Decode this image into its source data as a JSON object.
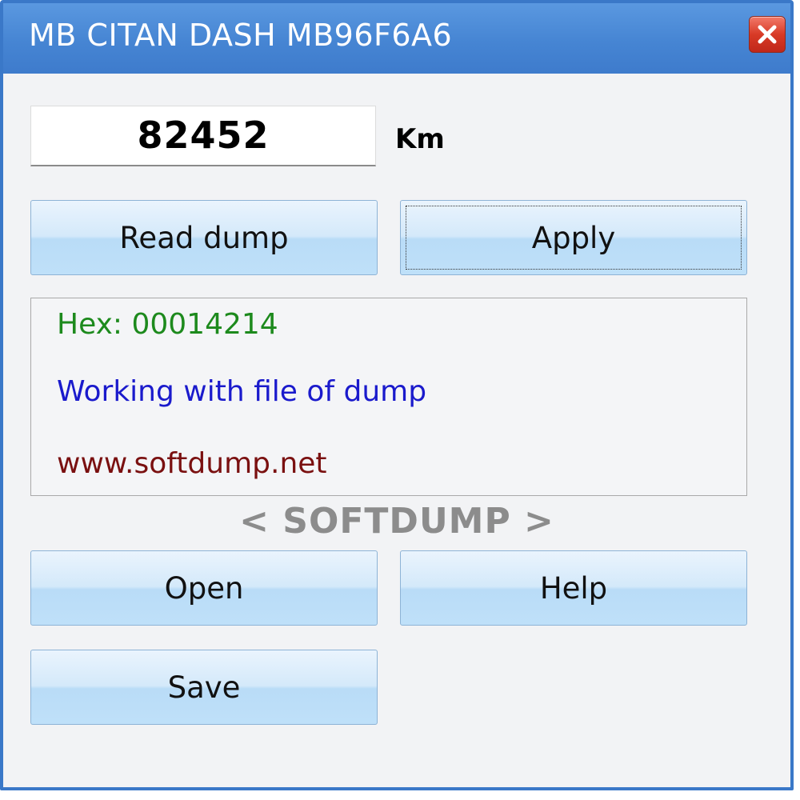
{
  "window": {
    "title": "MB CITAN DASH MB96F6A6"
  },
  "mileage": {
    "value": "82452",
    "unit": "Km"
  },
  "buttons": {
    "read_dump": "Read dump",
    "apply": "Apply",
    "open": "Open",
    "help": "Help",
    "save": "Save"
  },
  "info": {
    "hex": "Hex: 00014214",
    "status": "Working with file of dump",
    "url": "www.softdump.net"
  },
  "brand": "< SOFTDUMP >",
  "colors": {
    "titlebar": "#4685d3",
    "hex_text": "#1d8a1d",
    "status_text": "#1a1acc",
    "url_text": "#7a1010",
    "brand_text": "#8c8c8c"
  },
  "icons": {
    "close": "close-icon"
  }
}
